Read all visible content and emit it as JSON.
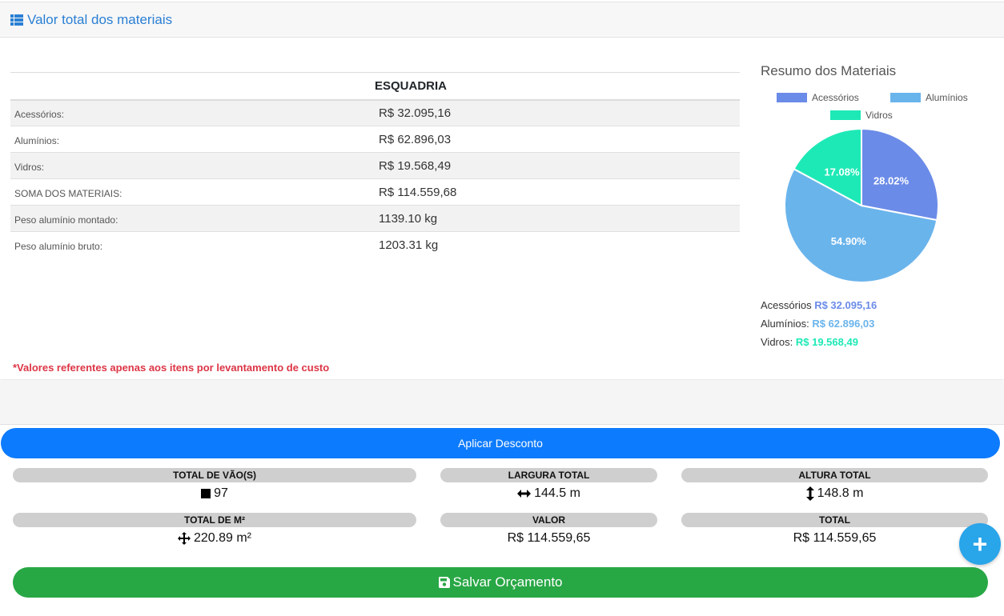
{
  "header": {
    "title": "Valor total dos materiais",
    "icon": "list-icon"
  },
  "table": {
    "column_header": "ESQUADRIA",
    "rows": [
      {
        "label": "Acessórios:",
        "value": "R$ 32.095,16"
      },
      {
        "label": "Alumínios:",
        "value": "R$ 62.896,03"
      },
      {
        "label": "Vidros:",
        "value": "R$ 19.568,49"
      },
      {
        "label": "SOMA DOS MATERIAIS:",
        "value": "R$ 114.559,68"
      },
      {
        "label": "Peso alumínio montado:",
        "value": "1139.10 kg"
      },
      {
        "label": "Peso alumínio bruto:",
        "value": "1203.31 kg"
      }
    ]
  },
  "note": "*Valores referentes apenas aos itens por levantamento de custo",
  "summary": {
    "title": "Resumo dos Materiais",
    "totals": [
      {
        "label": "Acessórios",
        "value": "R$ 32.095,16",
        "color": "#6b8be8"
      },
      {
        "label": "Alumínios:",
        "value": "R$ 62.896,03",
        "color": "#6ab4ec"
      },
      {
        "label": "Vidros:",
        "value": "R$ 19.568,49",
        "color": "#1de9b6"
      }
    ]
  },
  "chart_data": {
    "type": "pie",
    "title": "",
    "labels": [
      "Acessórios",
      "Alumínios",
      "Vidros"
    ],
    "values": [
      28.02,
      54.9,
      17.08
    ],
    "value_labels": [
      "28.02%",
      "54.90%",
      "17.08%"
    ],
    "colors": [
      "#6b8be8",
      "#6ab4ec",
      "#1de9b6"
    ],
    "legend_placement": "top"
  },
  "actions": {
    "discount_label": "Aplicar Desconto",
    "save_label": "Salvar Orçamento",
    "fab_label": "+"
  },
  "stats": {
    "vaos": {
      "label": "TOTAL DE VÃO(S)",
      "value": "97",
      "icon": "square-icon"
    },
    "largura": {
      "label": "LARGURA TOTAL",
      "value": "144.5 m",
      "icon": "arrows-horizontal-icon"
    },
    "altura": {
      "label": "ALTURA TOTAL",
      "value": "148.8 m",
      "icon": "arrows-vertical-icon"
    },
    "m2": {
      "label": "TOTAL DE M²",
      "value": "220.89 m²",
      "icon": "arrows-move-icon"
    },
    "valor": {
      "label": "VALOR",
      "value": "R$ 114.559,65"
    },
    "total": {
      "label": "TOTAL",
      "value": "R$ 114.559,65"
    }
  },
  "colors": {
    "primary": "#0d7bfd",
    "success": "#28a745",
    "danger": "#dc3545",
    "fab": "#29a5ea"
  }
}
